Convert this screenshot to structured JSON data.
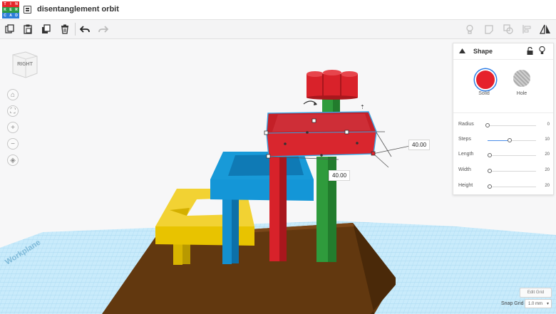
{
  "app": {
    "logo_letters": [
      "T",
      "I",
      "N",
      "K",
      "E",
      "R",
      "C",
      "A",
      "D"
    ],
    "logo_colors": [
      "#e6262c",
      "#e6262c",
      "#e6262c",
      "#2d9b48",
      "#2d9b48",
      "#2d9b48",
      "#2c7dd8",
      "#2c7dd8",
      "#2c7dd8"
    ],
    "design_title": "disentanglement orbit"
  },
  "toolbar": {
    "left_tools": [
      "copy-icon",
      "paste-icon",
      "duplicate-icon",
      "delete-icon",
      "undo-icon",
      "redo-icon"
    ],
    "right_tools": [
      "light-bulb-icon",
      "note-icon",
      "group-icon",
      "align-icon",
      "mirror-icon"
    ]
  },
  "viewcube": {
    "face": "RIGHT"
  },
  "nav": [
    "home-icon",
    "fit-icon",
    "zoom-in-icon",
    "zoom-out-icon",
    "perspective-icon"
  ],
  "workplane": {
    "label": "Workplane"
  },
  "dimensions": {
    "width_label": "40.00",
    "depth_label": "40.00"
  },
  "shape_panel": {
    "title": "Shape",
    "solid_label": "Solid",
    "hole_label": "Hole",
    "selected_mode": "solid",
    "colors": {
      "solid": "#e6212b",
      "accent": "#2d7de5"
    },
    "params": [
      {
        "label": "Radius",
        "value": "0",
        "fraction": 0.0
      },
      {
        "label": "Steps",
        "value": "10",
        "fraction": 0.45
      },
      {
        "label": "Length",
        "value": "20",
        "fraction": 0.05
      },
      {
        "label": "Width",
        "value": "20",
        "fraction": 0.05
      },
      {
        "label": "Height",
        "value": "20",
        "fraction": 0.05
      }
    ]
  },
  "grid": {
    "edit_label": "Edit Grid",
    "snap_label": "Snap Grid",
    "snap_value": "1.0 mm"
  }
}
